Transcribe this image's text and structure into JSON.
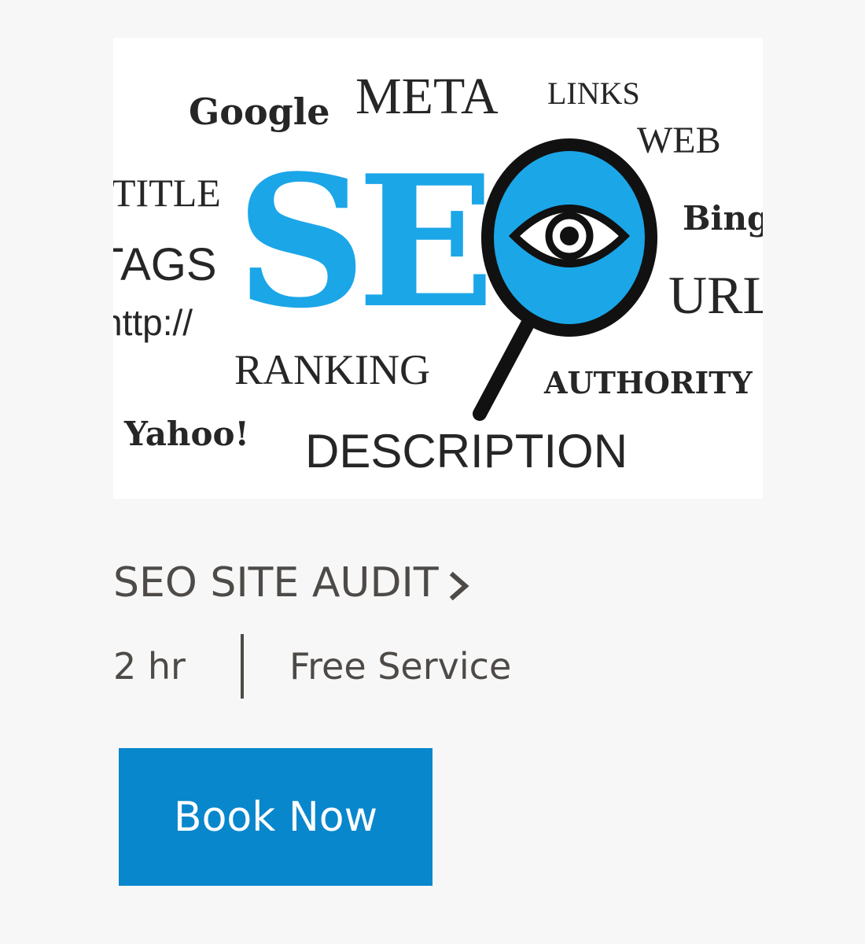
{
  "service": {
    "image": {
      "words": {
        "google": "Google",
        "meta": "META",
        "links": "LINKS",
        "web": "WEB",
        "title": "TITLE",
        "seo_s": "S",
        "seo_e": "E",
        "bing": "Bing",
        "tags": "TAGS",
        "url": "URL",
        "http": "http://",
        "ranking": "RANKING",
        "authority": "AUTHORITY",
        "yahoo": "Yahoo!",
        "description": "DESCRIPTION"
      },
      "colors": {
        "seo_blue": "#1ba6e8",
        "word_dark": "#262626"
      }
    },
    "title": "SEO SITE AUDIT",
    "title_icon": "chevron-right-icon",
    "duration": "2 hr",
    "price": "Free Service",
    "book_label": "Book Now",
    "colors": {
      "button": "#0887cc",
      "text": "#4d4a47",
      "background": "#f7f7f7"
    }
  }
}
